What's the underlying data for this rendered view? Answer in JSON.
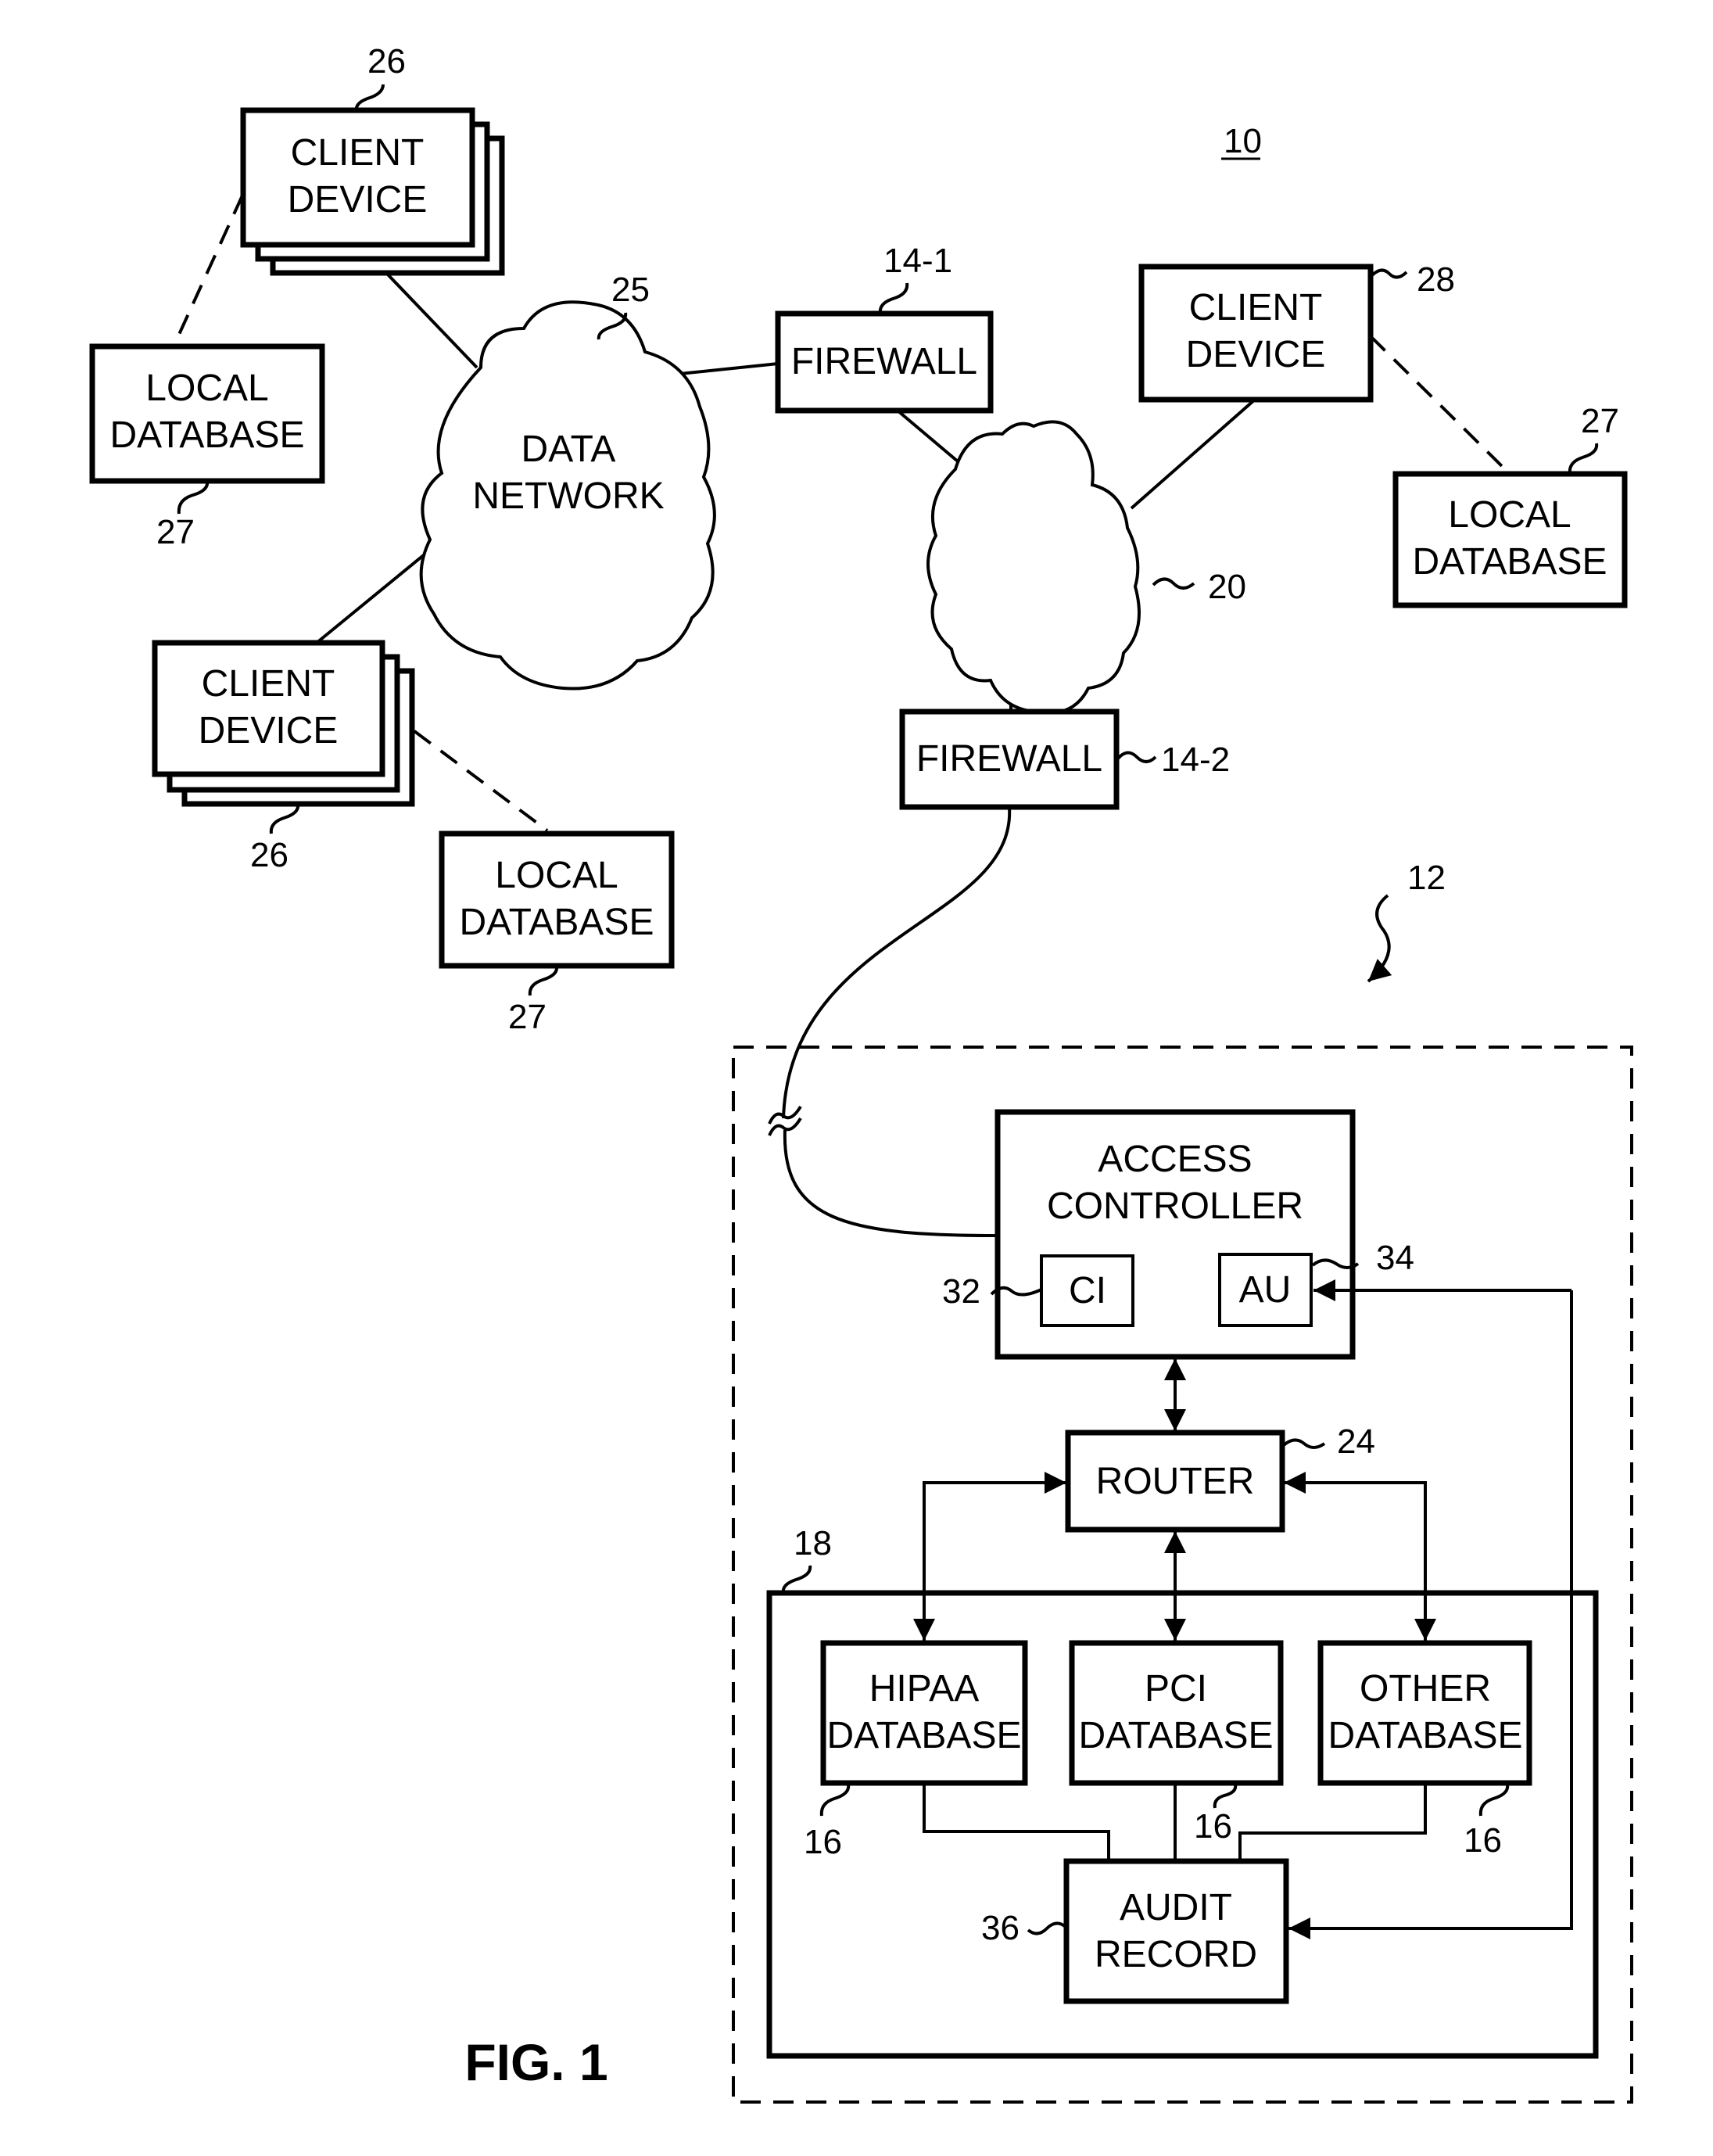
{
  "figure": {
    "title": "FIG. 1",
    "system_ref": "10",
    "enterprise_ref": "12"
  },
  "nodes": {
    "client_device_top": {
      "line1": "CLIENT",
      "line2": "DEVICE",
      "ref": "26"
    },
    "local_db_top_left": {
      "line1": "LOCAL",
      "line2": "DATABASE",
      "ref": "27"
    },
    "data_network": {
      "line1": "DATA",
      "line2": "NETWORK",
      "ref": "25"
    },
    "firewall_1": {
      "label": "FIREWALL",
      "ref": "14-1"
    },
    "cloud_20": {
      "ref": "20"
    },
    "client_device_right": {
      "line1": "CLIENT",
      "line2": "DEVICE",
      "ref": "28"
    },
    "local_db_right": {
      "line1": "LOCAL",
      "line2": "DATABASE",
      "ref": "27"
    },
    "client_device_lower": {
      "line1": "CLIENT",
      "line2": "DEVICE",
      "ref": "26"
    },
    "local_db_lower": {
      "line1": "LOCAL",
      "line2": "DATABASE",
      "ref": "27"
    },
    "firewall_2": {
      "label": "FIREWALL",
      "ref": "14-2"
    },
    "access_controller": {
      "line1": "ACCESS",
      "line2": "CONTROLLER"
    },
    "ci": {
      "label": "CI",
      "ref": "32"
    },
    "au": {
      "label": "AU",
      "ref": "34"
    },
    "router": {
      "label": "ROUTER",
      "ref": "24"
    },
    "database_group": {
      "ref": "18"
    },
    "hipaa_db": {
      "line1": "HIPAA",
      "line2": "DATABASE",
      "ref": "16"
    },
    "pci_db": {
      "line1": "PCI",
      "line2": "DATABASE",
      "ref": "16"
    },
    "other_db": {
      "line1": "OTHER",
      "line2": "DATABASE",
      "ref": "16"
    },
    "audit_record": {
      "line1": "AUDIT",
      "line2": "RECORD",
      "ref": "36"
    }
  }
}
